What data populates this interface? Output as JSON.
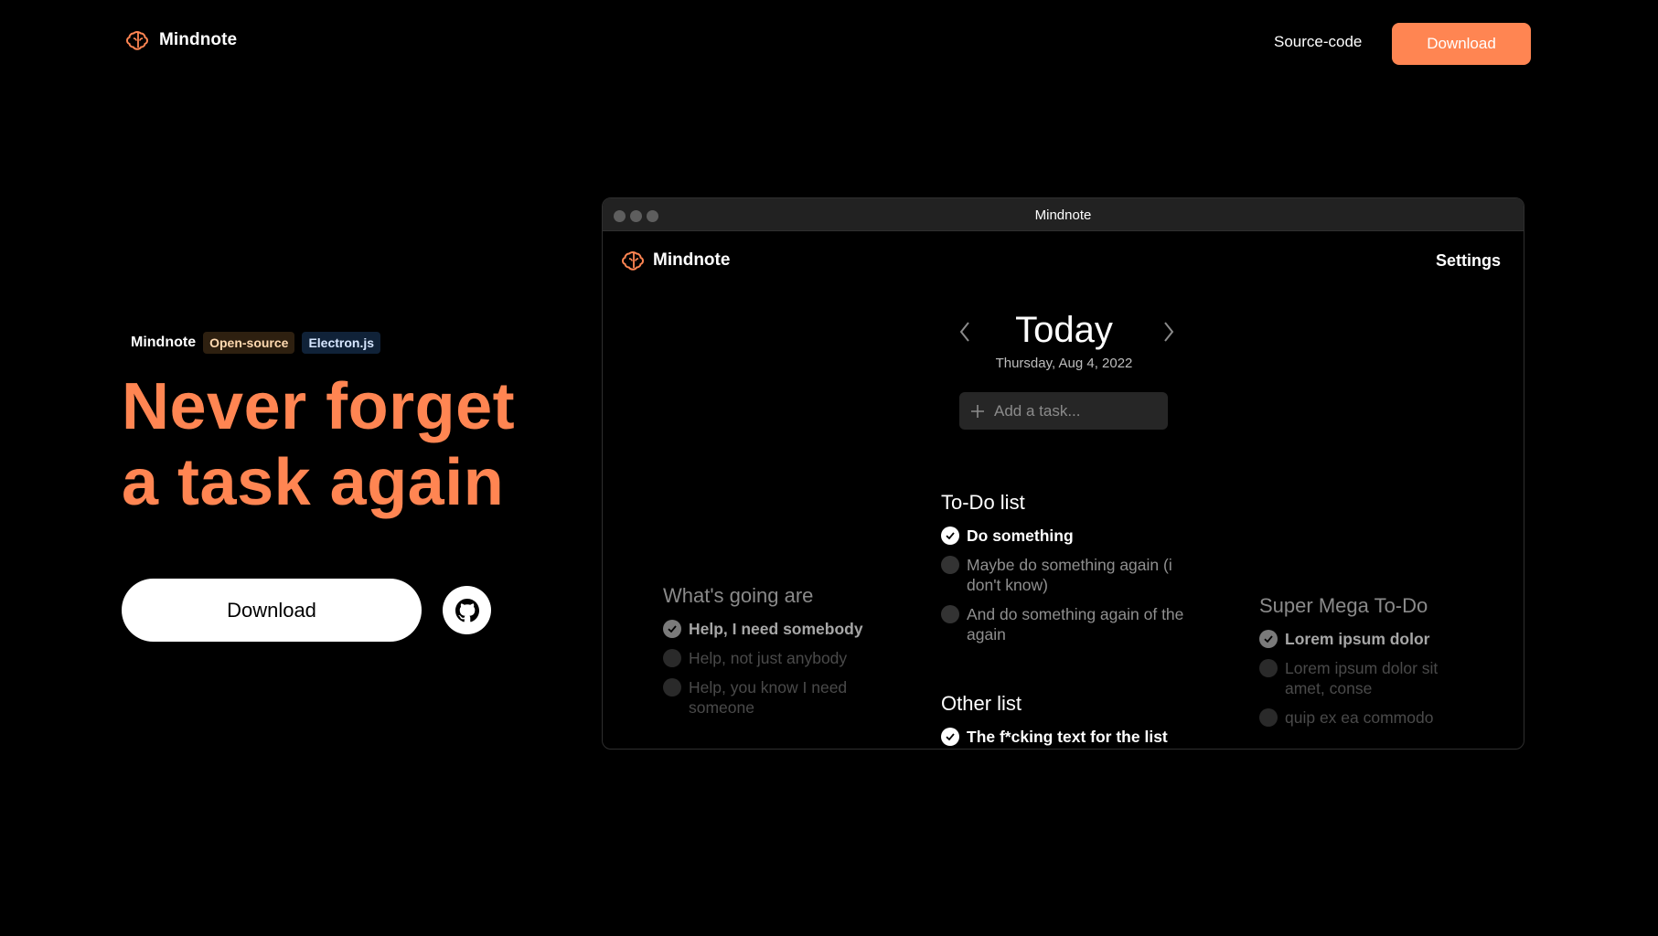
{
  "nav": {
    "brand": "Mindnote",
    "source_code": "Source-code",
    "download": "Download"
  },
  "hero": {
    "tag_name": "Mindnote",
    "tag_open_source": "Open-source",
    "tag_electron": "Electron.js",
    "headline_line1": "Never forget",
    "headline_line2": "a task again",
    "download": "Download"
  },
  "colors": {
    "accent": "#ff8552",
    "background": "#000000"
  },
  "app": {
    "window_title": "Mindnote",
    "brand": "Mindnote",
    "settings": "Settings",
    "day_title": "Today",
    "day_date": "Thursday, Aug 4, 2022",
    "add_task_placeholder": "Add a task...",
    "lists": {
      "todo": {
        "title": "To-Do list",
        "items": [
          {
            "text": "Do something",
            "done": true
          },
          {
            "text": "Maybe do something again (i don't know)",
            "done": false
          },
          {
            "text": "And do something again of the again",
            "done": false
          }
        ]
      },
      "other": {
        "title": "Other list",
        "items": [
          {
            "text": "The f*cking text for the list",
            "done": true
          }
        ]
      },
      "whats_going": {
        "title": "What's going are",
        "items": [
          {
            "text": "Help, I need somebody",
            "done": true
          },
          {
            "text": "Help, not just anybody",
            "done": false
          },
          {
            "text": "Help, you know I need someone",
            "done": false
          }
        ]
      },
      "super_mega": {
        "title": "Super Mega To-Do",
        "items": [
          {
            "text": "Lorem ipsum dolor",
            "done": true
          },
          {
            "text": "Lorem ipsum dolor sit amet, conse",
            "done": false
          },
          {
            "text": "quip ex ea commodo",
            "done": false
          }
        ]
      }
    }
  }
}
